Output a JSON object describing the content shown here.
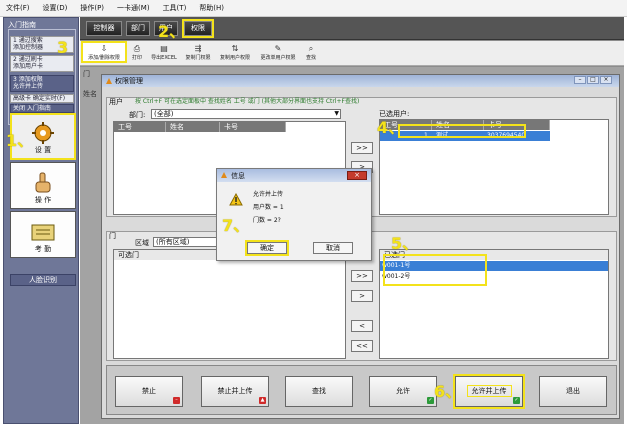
{
  "menu": [
    "文件(F)",
    "设置(D)",
    "操作(P)",
    "一卡通(M)",
    "工具(T)",
    "帮助(H)"
  ],
  "sidebar": {
    "title": "入门指南",
    "guides": [
      {
        "text": "1  通过搜索\n   添加控制器"
      },
      {
        "text": "2  通过刷卡\n   添加用户卡"
      },
      {
        "text": "3  添加权限\n   允许并上传"
      },
      {
        "text": "高级卡 确定实时(F)"
      },
      {
        "text": "关闭 入门指南"
      }
    ],
    "buttons": [
      {
        "label": "设 置"
      },
      {
        "label": "操 作"
      },
      {
        "label": "考 勤"
      }
    ],
    "face_button": "人脸识别"
  },
  "topbar": {
    "controllers": "控制器",
    "departments": "部门",
    "users": "用户",
    "permissions": "权限"
  },
  "toolbar": {
    "items": [
      {
        "label": "添加/删除权限",
        "icon": "⇩"
      },
      {
        "label": "打印",
        "icon": "⎙"
      },
      {
        "label": "导出EXCEL",
        "icon": "▤"
      },
      {
        "label": "复制门权限",
        "icon": "⇶"
      },
      {
        "label": "复制用户权限",
        "icon": "⇅"
      },
      {
        "label": "更改单用户权限",
        "icon": "✎"
      },
      {
        "label": "查找",
        "icon": "⌕"
      }
    ]
  },
  "background": {
    "door_label": "门",
    "name_label": "姓名"
  },
  "dialog": {
    "title": "权限管理",
    "hint": "按 Ctrl+F 可在选定面板中 查找姓名 工号 或门 (其他大部分界面也支持 Ctrl+F查找)",
    "user_group": "用户",
    "dept_label": "部门:",
    "dept_value": "(全部)",
    "user_cols": [
      "工号",
      "姓名",
      "卡号"
    ],
    "selected_users_label": "已选用户:",
    "selected_user_cols": [
      "工号",
      "姓名",
      "卡号"
    ],
    "selected_user_row": {
      "no": "1",
      "name": "测试",
      "card": "3037694540"
    },
    "door_group": "门",
    "area_label": "区域",
    "area_value": "(所有区域)",
    "door_col": "可选门",
    "selected_door_col": "已选门",
    "selected_doors": [
      "w001-1号",
      "w001-2号"
    ],
    "move_all_right": ">>",
    "move_right": ">",
    "move_left": "<",
    "move_all_left": "<<"
  },
  "bottom": {
    "forbid": "禁止",
    "forbid_upload": "禁止并上传",
    "find": "查找",
    "allow": "允许",
    "allow_upload": "允许并上传",
    "exit": "退出"
  },
  "message": {
    "title": "信息",
    "line1": "允许并上传",
    "line2": "用户数 = 1",
    "line3": "门数 = 2?",
    "ok": "确定",
    "cancel": "取消"
  },
  "annotations": [
    "1、",
    "2、",
    "3",
    "4、",
    "5、",
    "6、",
    "7、"
  ]
}
